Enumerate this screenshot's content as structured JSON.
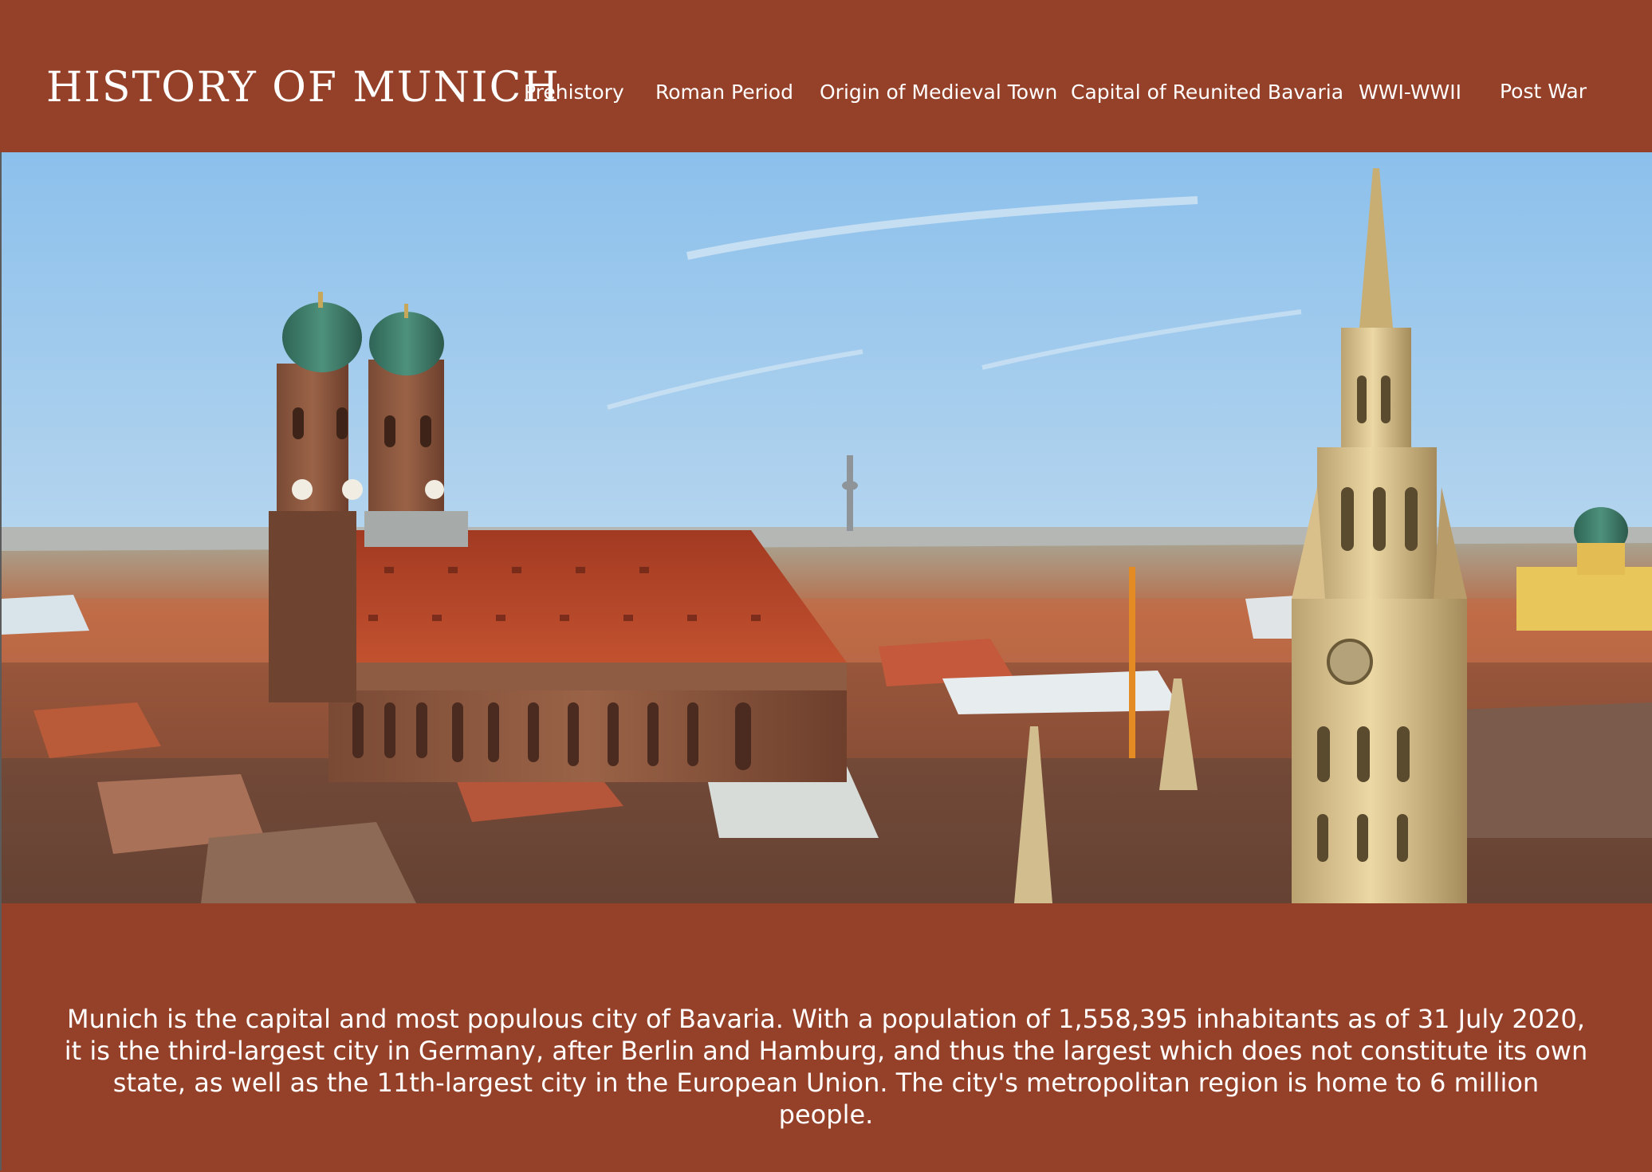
{
  "header": {
    "title": "HISTORY OF MUNICH",
    "nav": [
      "Prehistory",
      "Roman Period",
      "Origin of Medieval Town",
      "Capital of Reunited Bavaria",
      "WWI-WWII",
      "Post War"
    ]
  },
  "hero": {
    "icon": "munich-skyline-photo"
  },
  "intro": {
    "text": "Munich is the capital and most populous city of Bavaria. With a population of 1,558,395 inhabitants as of 31 July 2020, it is the third-largest city in Germany, after Berlin and Hamburg, and thus the largest which does not constitute its own state, as well as the 11th-largest city in the European Union. The city's metropolitan region is home to 6 million people."
  },
  "colors": {
    "background": "#954129",
    "text": "#ffffff",
    "sky": "#9cc6ea",
    "roof": "#b1452c",
    "dome": "#3f7d6c",
    "tower_stone": "#e0c891"
  }
}
